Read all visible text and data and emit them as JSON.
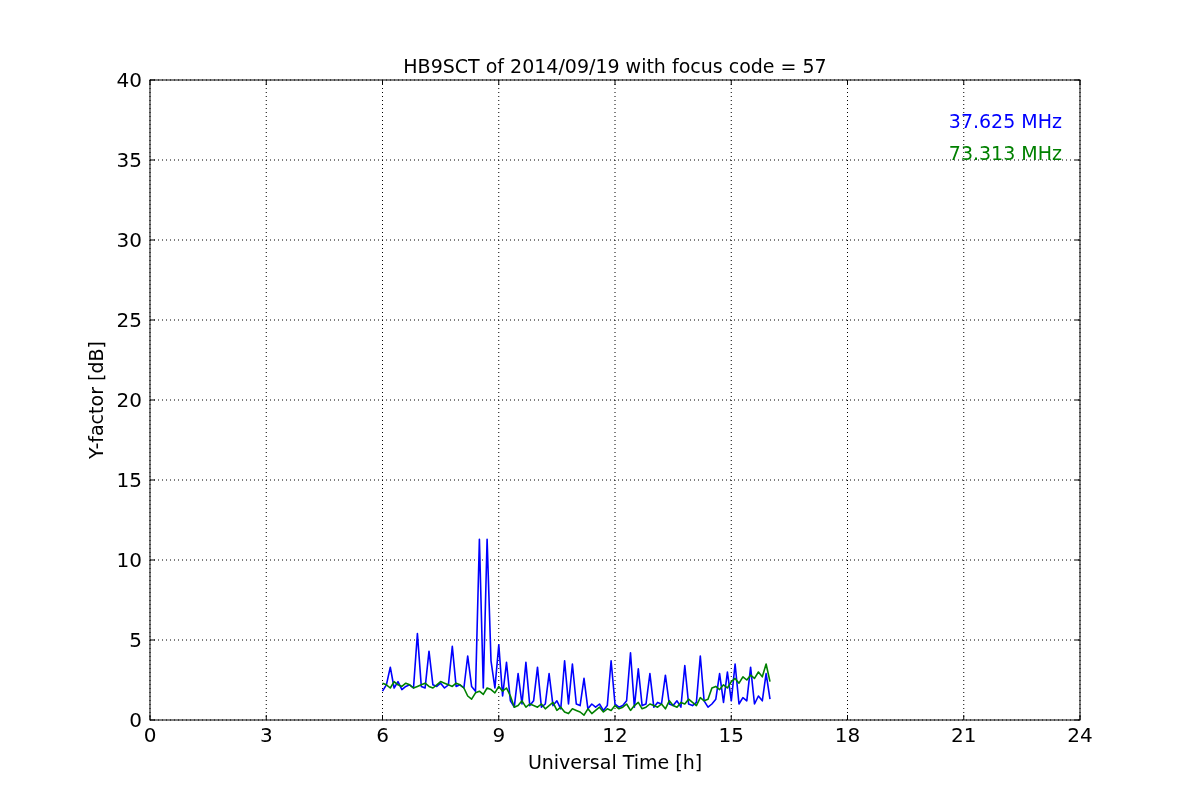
{
  "chart_data": {
    "type": "line",
    "title": "HB9SCT of 2014/09/19 with focus code = 57",
    "xlabel": "Universal Time [h]",
    "ylabel": "Y-factor [dB]",
    "grid": true,
    "xlim": [
      0,
      24
    ],
    "ylim": [
      0,
      40
    ],
    "xticks": [
      0,
      3,
      6,
      9,
      12,
      15,
      18,
      21,
      24
    ],
    "yticks": [
      0,
      5,
      10,
      15,
      20,
      25,
      30,
      35,
      40
    ],
    "x": [
      6.0,
      6.1,
      6.2,
      6.3,
      6.4,
      6.5,
      6.6,
      6.7,
      6.8,
      6.9,
      7.0,
      7.1,
      7.2,
      7.3,
      7.4,
      7.5,
      7.6,
      7.7,
      7.8,
      7.9,
      8.0,
      8.1,
      8.2,
      8.3,
      8.4,
      8.5,
      8.6,
      8.7,
      8.8,
      8.9,
      9.0,
      9.1,
      9.2,
      9.3,
      9.4,
      9.5,
      9.6,
      9.7,
      9.8,
      9.9,
      10.0,
      10.1,
      10.2,
      10.3,
      10.4,
      10.5,
      10.6,
      10.7,
      10.8,
      10.9,
      11.0,
      11.1,
      11.2,
      11.3,
      11.4,
      11.5,
      11.6,
      11.7,
      11.8,
      11.9,
      12.0,
      12.1,
      12.2,
      12.3,
      12.4,
      12.5,
      12.6,
      12.7,
      12.8,
      12.9,
      13.0,
      13.1,
      13.2,
      13.3,
      13.4,
      13.5,
      13.6,
      13.7,
      13.8,
      13.9,
      14.0,
      14.1,
      14.2,
      14.3,
      14.4,
      14.5,
      14.6,
      14.7,
      14.8,
      14.9,
      15.0,
      15.1,
      15.2,
      15.3,
      15.4,
      15.5,
      15.6,
      15.7,
      15.8,
      15.9,
      16.0
    ],
    "series": [
      {
        "name": "37.625 MHz",
        "color": "#0000ff",
        "values": [
          1.8,
          2.2,
          3.3,
          2.0,
          2.4,
          1.9,
          2.1,
          2.2,
          2.0,
          5.4,
          2.1,
          2.0,
          4.3,
          2.2,
          2.1,
          2.3,
          2.0,
          2.2,
          4.6,
          2.1,
          2.2,
          2.0,
          4.0,
          2.1,
          1.8,
          11.3,
          2.0,
          11.3,
          3.7,
          2.0,
          4.7,
          1.5,
          3.6,
          1.2,
          0.8,
          2.9,
          1.0,
          3.6,
          0.9,
          1.2,
          3.3,
          0.8,
          1.0,
          2.9,
          0.9,
          1.2,
          0.7,
          3.7,
          1.0,
          3.5,
          1.0,
          0.9,
          2.6,
          0.7,
          1.0,
          0.8,
          1.0,
          0.6,
          0.9,
          3.7,
          1.0,
          0.8,
          0.9,
          1.2,
          4.2,
          0.8,
          3.2,
          0.9,
          1.0,
          2.9,
          0.8,
          1.1,
          1.0,
          2.8,
          1.0,
          0.9,
          1.2,
          0.8,
          3.4,
          1.0,
          0.9,
          1.1,
          4.0,
          1.2,
          0.8,
          1.0,
          1.3,
          2.9,
          1.1,
          3.0,
          1.2,
          3.5,
          1.0,
          1.4,
          1.2,
          3.3,
          1.0,
          1.5,
          1.2,
          2.9,
          1.3
        ]
      },
      {
        "name": "73.313 MHz",
        "color": "#008000",
        "values": [
          2.3,
          2.2,
          2.0,
          2.4,
          2.2,
          2.1,
          2.3,
          2.2,
          2.0,
          2.1,
          2.2,
          2.3,
          2.1,
          2.0,
          2.2,
          2.4,
          2.3,
          2.2,
          2.1,
          2.3,
          2.2,
          2.0,
          1.5,
          1.3,
          1.7,
          1.8,
          1.6,
          2.0,
          1.9,
          1.7,
          2.1,
          1.8,
          2.0,
          1.5,
          0.8,
          0.9,
          1.2,
          0.8,
          1.0,
          0.9,
          0.8,
          1.0,
          0.7,
          0.9,
          1.1,
          0.6,
          0.8,
          0.5,
          0.4,
          0.7,
          0.6,
          0.5,
          0.3,
          0.7,
          0.4,
          0.6,
          0.8,
          0.5,
          0.7,
          0.6,
          0.9,
          0.7,
          0.8,
          1.0,
          0.6,
          0.9,
          1.1,
          0.7,
          0.8,
          1.0,
          0.9,
          0.8,
          1.0,
          0.7,
          1.2,
          0.9,
          0.8,
          1.1,
          1.0,
          1.3,
          1.1,
          0.9,
          1.4,
          1.2,
          1.3,
          2.0,
          2.1,
          1.9,
          2.2,
          2.0,
          2.4,
          2.6,
          2.3,
          2.7,
          2.5,
          2.8,
          2.6,
          3.0,
          2.7,
          3.5,
          2.4
        ]
      }
    ]
  }
}
